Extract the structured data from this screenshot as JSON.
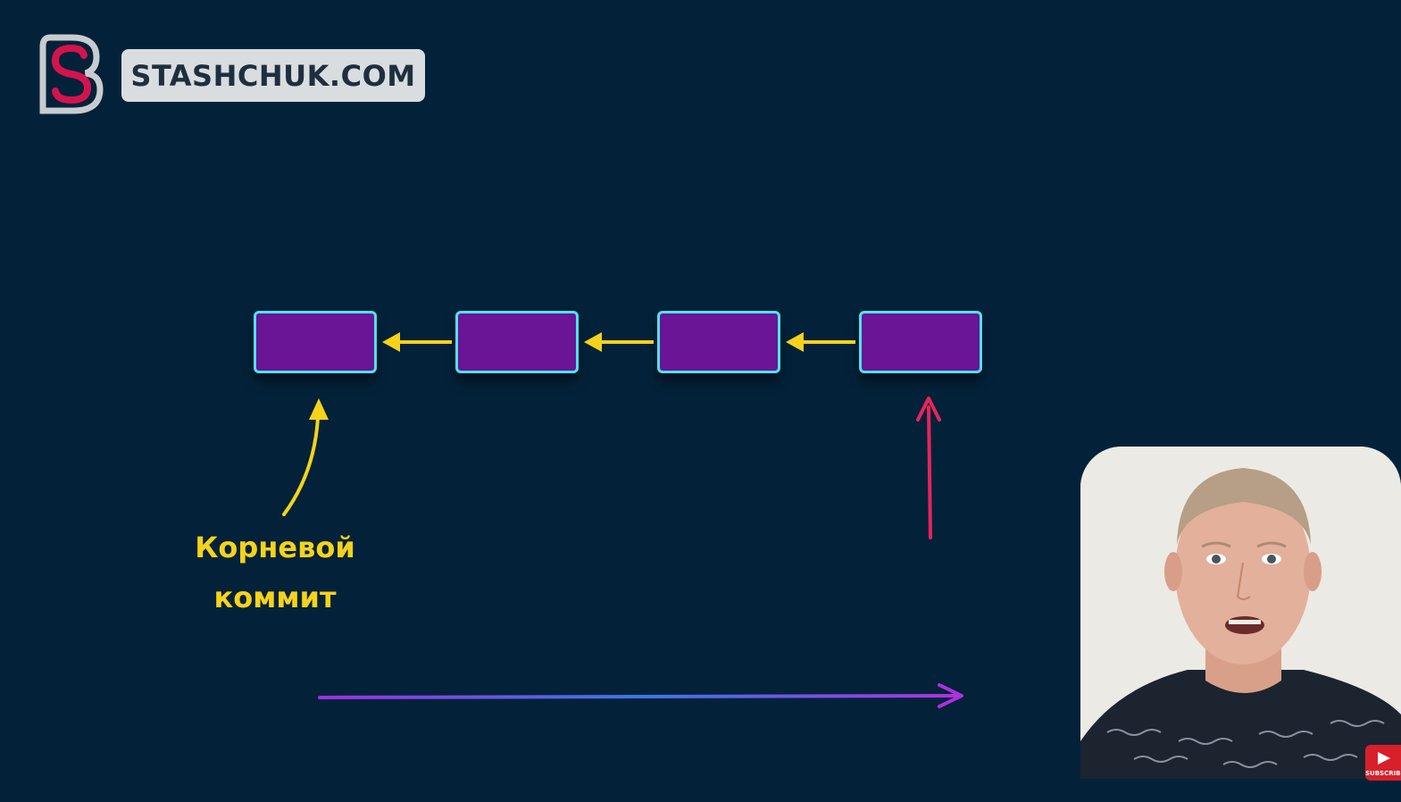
{
  "logo": {
    "brand_text": "STASHCHUK.COM",
    "mark_icon": "stashchuk-s-logo-icon"
  },
  "diagram": {
    "commits_count": 4,
    "commit_fill": "#6a1496",
    "commit_border": "#4de3ec",
    "parent_arrow_color": "#f5d21c",
    "pointer_arrow_color": "#e8245a",
    "timeline_gradient": [
      "#a030e0",
      "#3a78e6",
      "#b030e0"
    ],
    "root_label_lines": [
      "Корневой",
      "коммит"
    ]
  },
  "presenter": {
    "icon": "presenter-video-icon",
    "subscribe_text": "SUBSCRIBE"
  }
}
